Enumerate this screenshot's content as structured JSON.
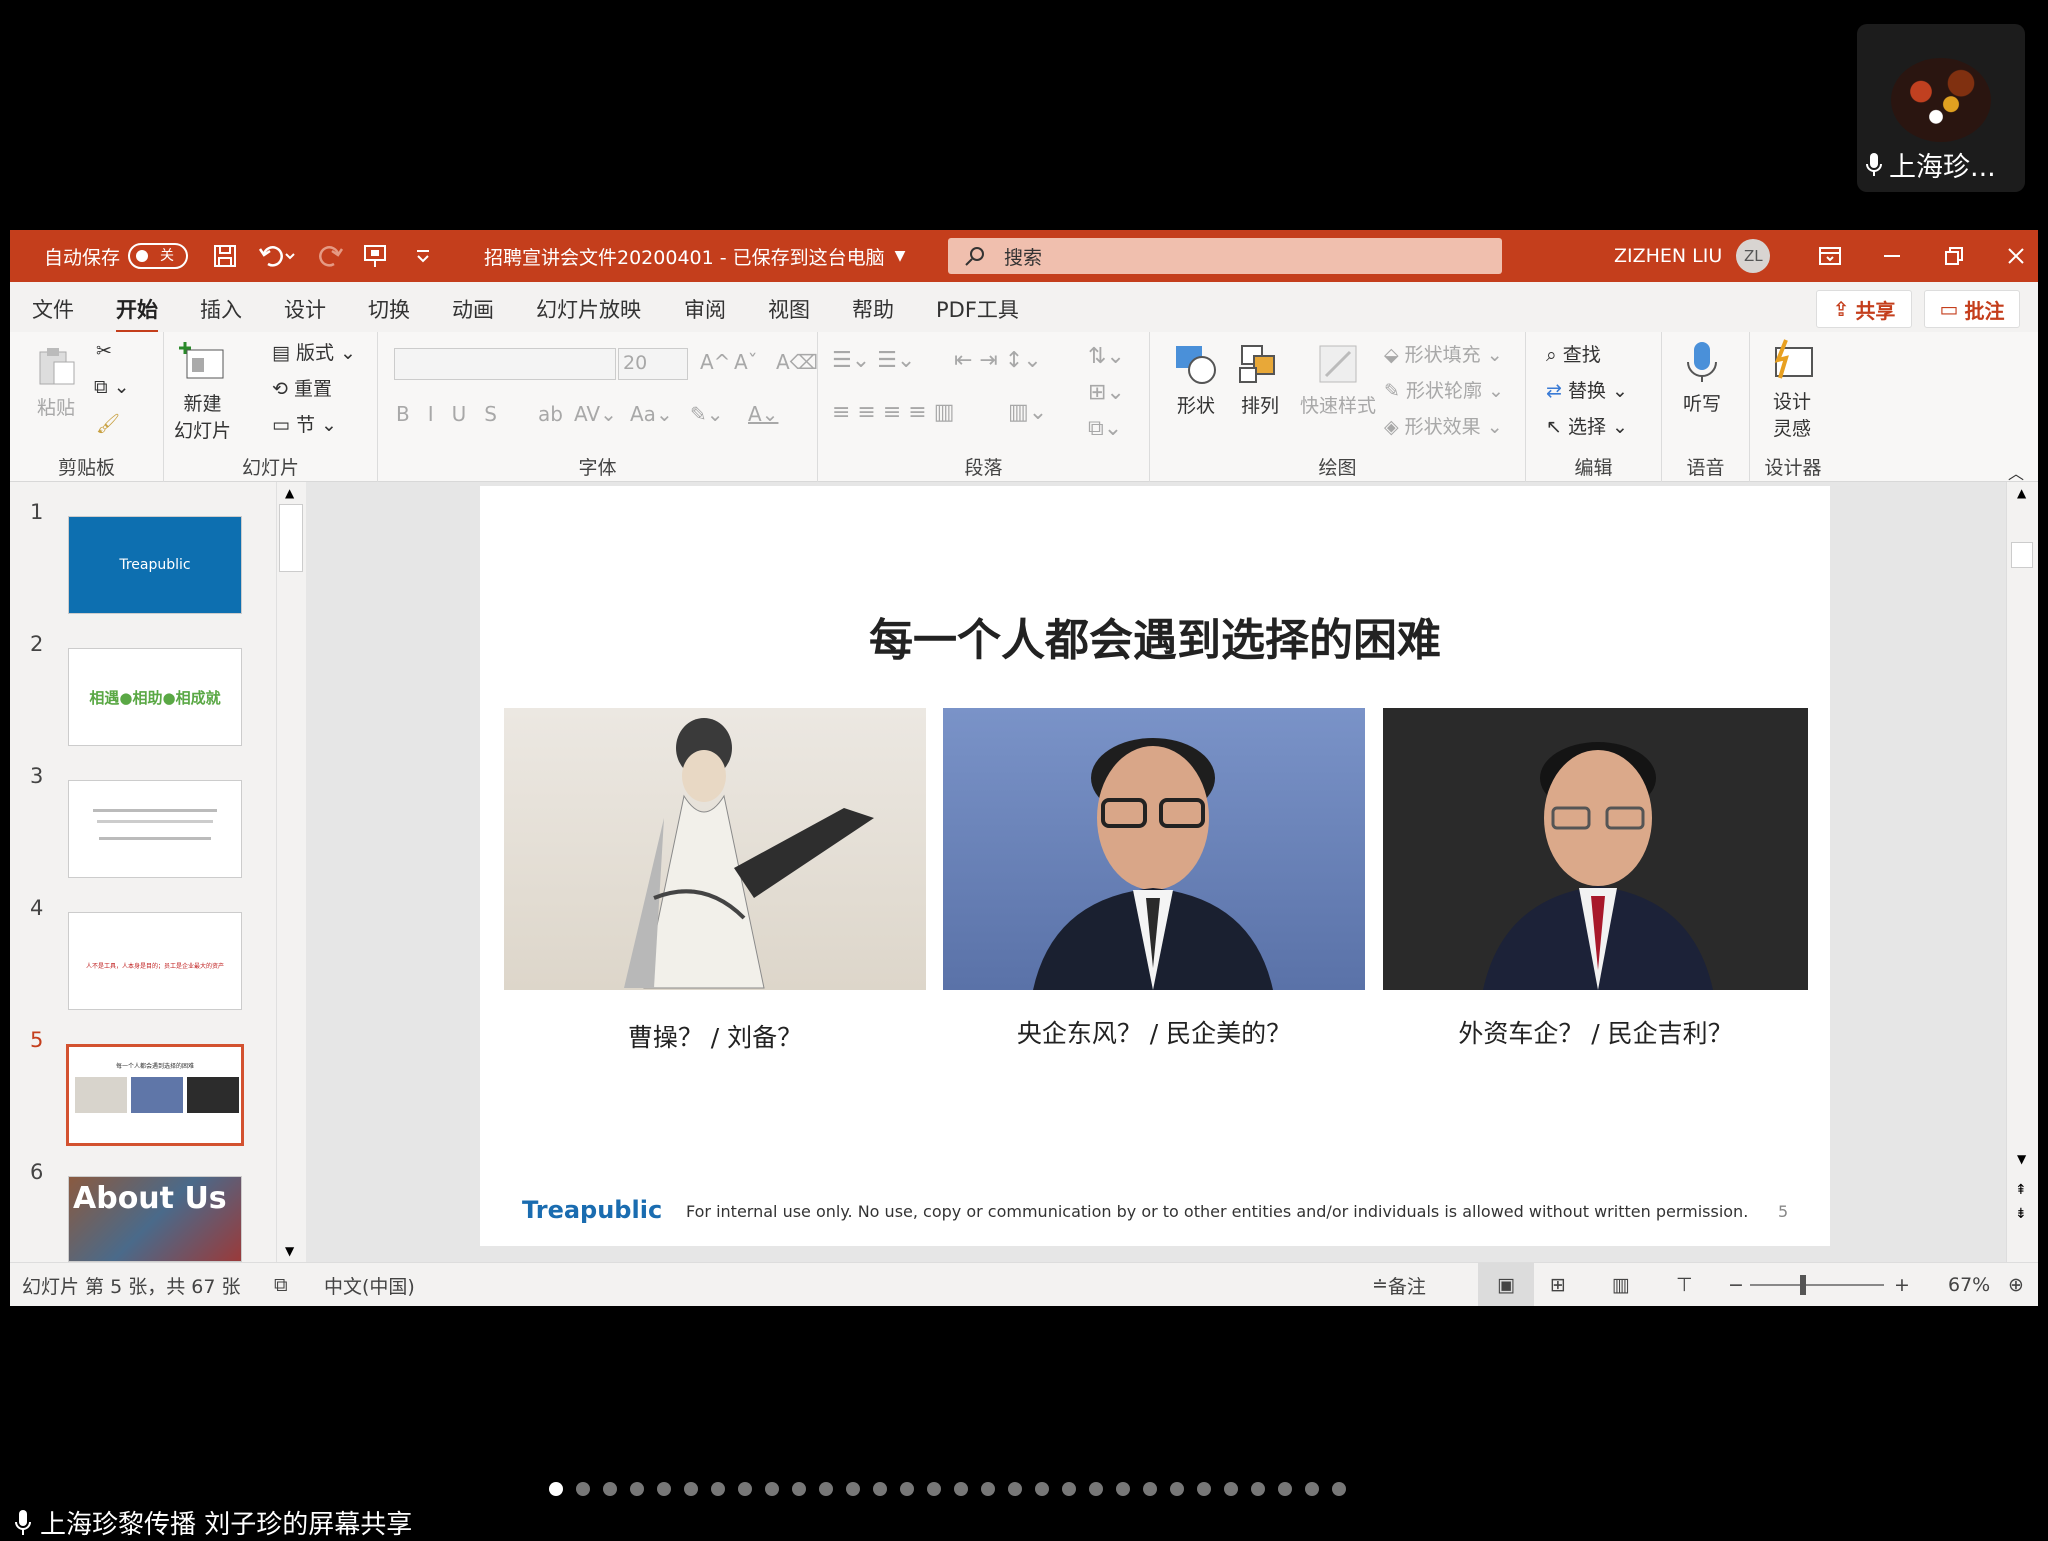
{
  "participant": {
    "name": "上海珍..."
  },
  "titlebar": {
    "autosave_label": "自动保存",
    "autosave_state": "关",
    "file_title": "招聘宣讲会文件20200401  -  已保存到这台电脑",
    "search_placeholder": "搜索",
    "user_name": "ZIZHEN LIU",
    "user_initials": "ZL"
  },
  "tabs": [
    "文件",
    "开始",
    "插入",
    "设计",
    "切换",
    "动画",
    "幻灯片放映",
    "审阅",
    "视图",
    "帮助",
    "PDF工具"
  ],
  "top_buttons": {
    "share": "共享",
    "comments": "批注"
  },
  "ribbon": {
    "clipboard": {
      "label": "剪贴板",
      "paste": "粘贴"
    },
    "slides": {
      "label": "幻灯片",
      "new_slide_1": "新建",
      "new_slide_2": "幻灯片",
      "layout": "版式",
      "reset": "重置",
      "section": "节"
    },
    "font": {
      "label": "字体",
      "size": "20"
    },
    "paragraph": {
      "label": "段落"
    },
    "drawing": {
      "label": "绘图",
      "shapes": "形状",
      "arrange": "排列",
      "quick_styles": "快速样式",
      "shape_fill": "形状填充",
      "shape_outline": "形状轮廓",
      "shape_effects": "形状效果"
    },
    "editing": {
      "label": "编辑",
      "find": "查找",
      "replace": "替换",
      "select": "选择"
    },
    "voice": {
      "label": "语音",
      "dictate": "听写"
    },
    "designer": {
      "label": "设计器",
      "ideas_1": "设计",
      "ideas_2": "灵感"
    }
  },
  "thumbnails": [
    {
      "num": "1",
      "text": "Treapublic"
    },
    {
      "num": "2",
      "text": "相遇●相助●相成就"
    },
    {
      "num": "3",
      "text": ""
    },
    {
      "num": "4",
      "text": "人不是工具，人本身是目的；员工是企业最大的资产"
    },
    {
      "num": "5",
      "text": "每一个人都会遇到选择的困难"
    },
    {
      "num": "6",
      "text": "About Us"
    }
  ],
  "slide": {
    "title": "每一个人都会遇到选择的困难",
    "captions": [
      "曹操？ / 刘备？",
      "央企东风？ / 民企美的？",
      "外资车企？ / 民企吉利？"
    ],
    "logo": "Treapublic",
    "footer_text": "For internal use only.  No use, copy or communication by or to other entities and/or individuals is allowed without written permission.",
    "page_number": "5"
  },
  "statusbar": {
    "slide_info": "幻灯片 第 5 张，共 67 张",
    "language": "中文(中国)",
    "notes": "备注",
    "zoom": "67%"
  },
  "screen_share": {
    "label": "上海珍黎传播 刘子珍的屏幕共享",
    "page_count": 30,
    "current_page": 1
  },
  "colors": {
    "accent": "#c43e1c",
    "highlight": "#d35230"
  }
}
